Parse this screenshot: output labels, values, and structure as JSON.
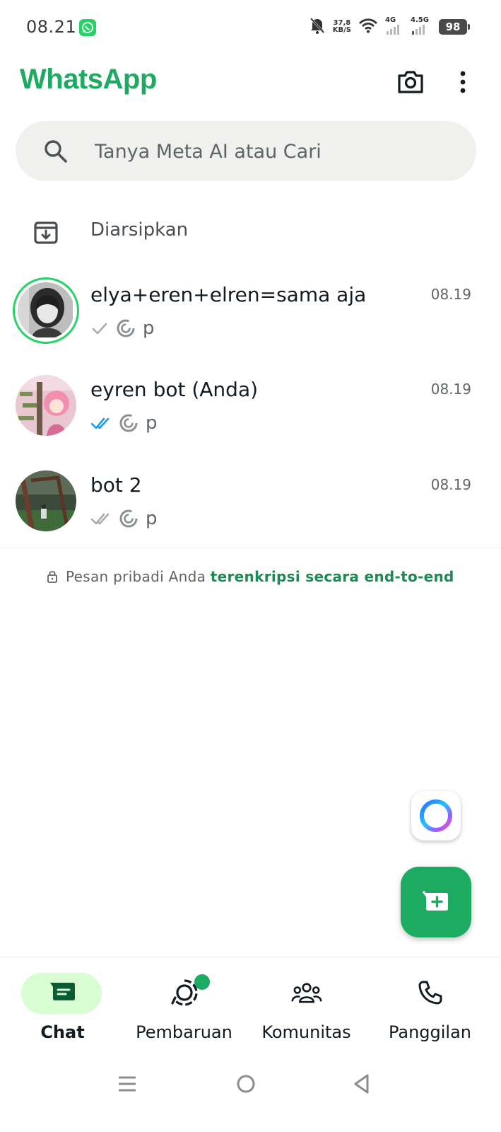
{
  "status_bar": {
    "time": "08.21",
    "speed_value": "37,8",
    "speed_unit": "KB/S",
    "net1": "4G",
    "net2": "4.5G",
    "battery": "98"
  },
  "app": {
    "title": "WhatsApp",
    "brand_color": "#1daa61"
  },
  "search": {
    "placeholder": "Tanya Meta AI atau Cari"
  },
  "archived": {
    "label": "Diarsipkan"
  },
  "chats": [
    {
      "name": "elya+eren+elren=sama aja",
      "time": "08.19",
      "preview": "p",
      "status": "sent-single-tick",
      "has_status_ring": true
    },
    {
      "name": "eyren bot (Anda)",
      "time": "08.19",
      "preview": "p",
      "status": "read-blue-ticks",
      "has_status_ring": false
    },
    {
      "name": "bot 2",
      "time": "08.19",
      "preview": "p",
      "status": "delivered-double-ticks",
      "has_status_ring": false
    }
  ],
  "encryption": {
    "prefix": "Pesan pribadi Anda",
    "link": "terenkripsi secara end-to-end"
  },
  "bottom_nav": [
    {
      "label": "Chat",
      "icon": "chat-icon",
      "active": true
    },
    {
      "label": "Pembaruan",
      "icon": "updates-icon",
      "active": false,
      "badge": true
    },
    {
      "label": "Komunitas",
      "icon": "communities-icon",
      "active": false
    },
    {
      "label": "Panggilan",
      "icon": "calls-icon",
      "active": false
    }
  ],
  "icons": {
    "camera": "camera-icon",
    "menu": "more-vert-icon",
    "search": "search-icon",
    "archive": "archive-icon",
    "meta_ai": "meta-ai-icon",
    "new_chat": "new-chat-icon"
  }
}
